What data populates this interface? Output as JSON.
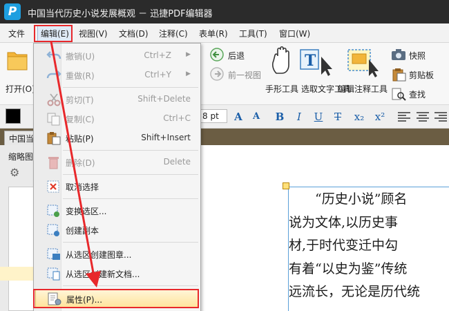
{
  "window": {
    "title": "中国当代历史小说发展概观 － 迅捷PDF编辑器",
    "logo": "P"
  },
  "menubar": [
    "文件",
    "编辑(E)",
    "视图(V)",
    "文档(D)",
    "注释(C)",
    "表单(R)",
    "工具(T)",
    "窗口(W)"
  ],
  "ribbon": {
    "open_label": "打开(O)",
    "back_label": "后退",
    "forward_label": "前一视图",
    "hand_tool": "手形工具",
    "select_text_tool": "选取文字工具",
    "edit_annot_tool": "编辑注释工具",
    "snapshot": "快照",
    "clipboard": "剪贴板",
    "find": "查找"
  },
  "format": {
    "font_size": "8 pt",
    "buttons": [
      "A",
      "A",
      "B",
      "I",
      "U",
      "T",
      "x₂",
      "x²"
    ]
  },
  "tab": {
    "doc_tab": "中国当",
    "thumbnails_title": "缩略图"
  },
  "edit_menu": [
    {
      "label": "撤销(U)",
      "shortcut": "Ctrl+Z",
      "submenu": true,
      "disabled": true,
      "icon": "undo-icon"
    },
    {
      "label": "重做(R)",
      "shortcut": "Ctrl+Y",
      "submenu": true,
      "disabled": true,
      "icon": "redo-icon"
    },
    {
      "label": "剪切(T)",
      "shortcut": "Shift+Delete",
      "disabled": true,
      "icon": "scissors-icon"
    },
    {
      "label": "复制(C)",
      "shortcut": "Ctrl+C",
      "disabled": true,
      "icon": "copy-icon"
    },
    {
      "label": "粘贴(P)",
      "shortcut": "Shift+Insert",
      "disabled": false,
      "icon": "paste-icon"
    },
    {
      "label": "删除(D)",
      "shortcut": "Delete",
      "disabled": true,
      "icon": "trash-icon"
    },
    {
      "label": "取消选择",
      "shortcut": "",
      "disabled": false,
      "icon": "deselect-icon"
    },
    {
      "label": "变换选区...",
      "shortcut": "",
      "disabled": false,
      "icon": "transform-selection-icon"
    },
    {
      "label": "创建副本",
      "shortcut": "",
      "disabled": false,
      "icon": "duplicate-icon"
    },
    {
      "label": "从选区创建图章...",
      "shortcut": "",
      "disabled": false,
      "icon": "stamp-icon"
    },
    {
      "label": "从选区创建新文档...",
      "shortcut": "",
      "disabled": false,
      "icon": "new-doc-icon"
    },
    {
      "label": "属性(P)...",
      "shortcut": "",
      "disabled": false,
      "icon": "properties-icon"
    }
  ],
  "document_lines": [
    "　　“历史小说”顾名",
    "说为文体,以历史事",
    "材,于时代变迁中勾",
    "有着“以史为鉴”传统",
    "远流长，无论是历代统"
  ],
  "colors": {
    "highlight_red": "#e8282b",
    "menu_hover": "#ffe39a",
    "title_bar": "#2b2b2b"
  }
}
